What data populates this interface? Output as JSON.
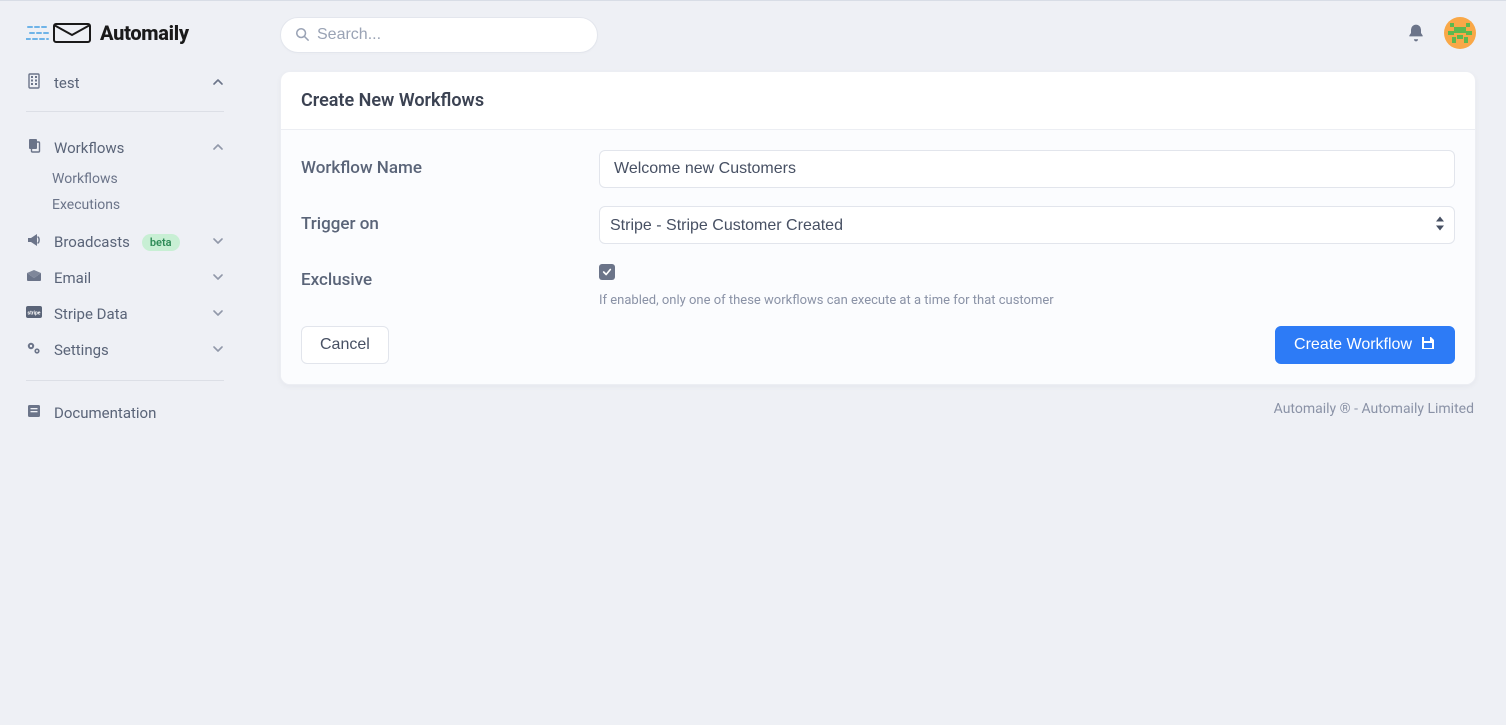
{
  "brand": {
    "name": "Automaily"
  },
  "search": {
    "placeholder": "Search..."
  },
  "project": {
    "name": "test"
  },
  "sidebar": {
    "workflows": {
      "label": "Workflows",
      "children": {
        "workflows": "Workflows",
        "executions": "Executions"
      }
    },
    "broadcasts": {
      "label": "Broadcasts",
      "badge": "beta"
    },
    "email": {
      "label": "Email"
    },
    "stripe": {
      "label": "Stripe Data"
    },
    "settings": {
      "label": "Settings"
    },
    "documentation": {
      "label": "Documentation"
    }
  },
  "page": {
    "title": "Create New Workflows",
    "form": {
      "name_label": "Workflow Name",
      "name_value": "Welcome new Customers",
      "trigger_label": "Trigger on",
      "trigger_value": "Stripe - Stripe Customer Created",
      "exclusive_label": "Exclusive",
      "exclusive_checked": true,
      "exclusive_help": "If enabled, only one of these workflows can execute at a time for that customer",
      "cancel_label": "Cancel",
      "submit_label": "Create Workflow"
    }
  },
  "footer": {
    "text": "Automaily ® - Automaily Limited"
  }
}
